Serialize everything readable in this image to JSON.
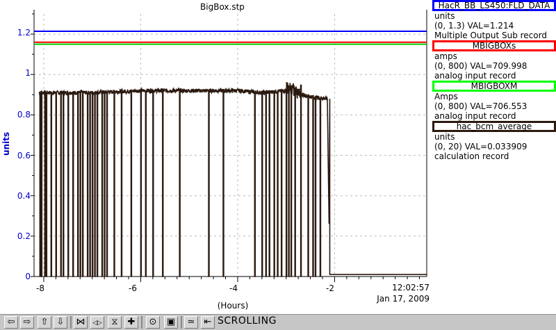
{
  "plot": {
    "title": "BigBox.stp",
    "ylabel": "units",
    "xunit": "(Hours)",
    "clock_time": "12:02:57",
    "clock_date": "Jan 17, 2009",
    "yticks": [
      "0",
      "0.2",
      "0.4",
      "0.6",
      "0.8",
      "1",
      "1.2"
    ],
    "xticks": [
      "-8",
      "-6",
      "-4",
      "-2"
    ]
  },
  "chart_data": {
    "type": "line",
    "title": "BigBox.stp",
    "xlabel": "(Hours)",
    "ylabel": "units",
    "xlim": [
      -8.2,
      -0.1
    ],
    "ylim": [
      0,
      1.3
    ],
    "grid": true,
    "series": [
      {
        "name": "HacR_BB_LS450:FLD_DATA",
        "color": "#0000ff",
        "x": [
          -8.2,
          -0.1
        ],
        "y": [
          1.214,
          1.214
        ]
      },
      {
        "name": "MBIGBOXs",
        "color": "#ff0000",
        "x": [
          -8.2,
          -0.1
        ],
        "y": [
          1.16,
          1.16
        ]
      },
      {
        "name": "MBIGBOXM",
        "color": "#00cc00",
        "x": [
          -8.2,
          -0.1
        ],
        "y": [
          1.15,
          1.15
        ]
      },
      {
        "name": "hac_bcm_average",
        "color": "#2b1a10",
        "x": [
          -8.1,
          -7.0,
          -6.0,
          -5.0,
          -4.0,
          -3.5,
          -3.0,
          -2.5,
          -2.15,
          -2.1,
          -2.05,
          -0.1
        ],
        "y": [
          0.91,
          0.91,
          0.92,
          0.92,
          0.92,
          0.91,
          0.92,
          0.89,
          0.88,
          0.0,
          0.01,
          0.01
        ]
      }
    ],
    "dropouts": [
      -8.08,
      -8.05,
      -7.98,
      -7.95,
      -7.85,
      -7.75,
      -7.65,
      -7.6,
      -7.5,
      -7.4,
      -7.3,
      -7.25,
      -7.2,
      -7.1,
      -7.05,
      -7.0,
      -6.95,
      -6.9,
      -6.8,
      -6.75,
      -6.7,
      -6.55,
      -6.4,
      -6.2,
      -6.0,
      -5.9,
      -5.75,
      -5.55,
      -5.2,
      -4.6,
      -4.3,
      -3.65,
      -3.5,
      -3.42,
      -3.35,
      -3.25,
      -3.18,
      -3.1,
      -3.0,
      -2.95,
      -2.9,
      -2.82,
      -2.7,
      -2.55,
      -2.45,
      -2.4,
      -2.3
    ]
  },
  "legend": [
    {
      "name": "HacR_BB_LS450:FLD_DATA",
      "color": "#0000ff",
      "units": "units",
      "range": "(0, 1.3) VAL=1.214",
      "record": "Multiple Output Sub record"
    },
    {
      "name": "MBIGBOXs",
      "color": "#ff0000",
      "units": "amps",
      "range": "(0, 800) VAL=709.998",
      "record": "analog input record"
    },
    {
      "name": "MBIGBOXM",
      "color": "#00ff00",
      "units": "Amps",
      "range": "(0, 800) VAL=706.553",
      "record": "analog input record"
    },
    {
      "name": "hac_bcm_average",
      "color": "#2b1a10",
      "units": "units",
      "range": "(0, 20) VAL=0.033909",
      "record": "calculation record"
    }
  ],
  "toolbar": {
    "status": "SCROLLING",
    "buttons": [
      {
        "name": "scroll-left-icon",
        "glyph": "⇦"
      },
      {
        "name": "scroll-right-icon",
        "glyph": "⇨"
      },
      {
        "name": "scroll-up-icon",
        "glyph": "⇧"
      },
      {
        "name": "scroll-down-icon",
        "glyph": "⇩"
      },
      {
        "name": "compress-x-icon",
        "glyph": "⋈"
      },
      {
        "name": "expand-x-icon",
        "glyph": "◁▷"
      },
      {
        "name": "compress-y-icon",
        "glyph": "⧖"
      },
      {
        "name": "expand-y-icon",
        "glyph": "✚"
      },
      {
        "name": "zoom-in-icon",
        "glyph": "⊙"
      },
      {
        "name": "zoom-out-icon",
        "glyph": "▣"
      },
      {
        "name": "auto-scale-icon",
        "glyph": "≃"
      },
      {
        "name": "scroll-mode-icon",
        "glyph": "⇤"
      }
    ]
  }
}
